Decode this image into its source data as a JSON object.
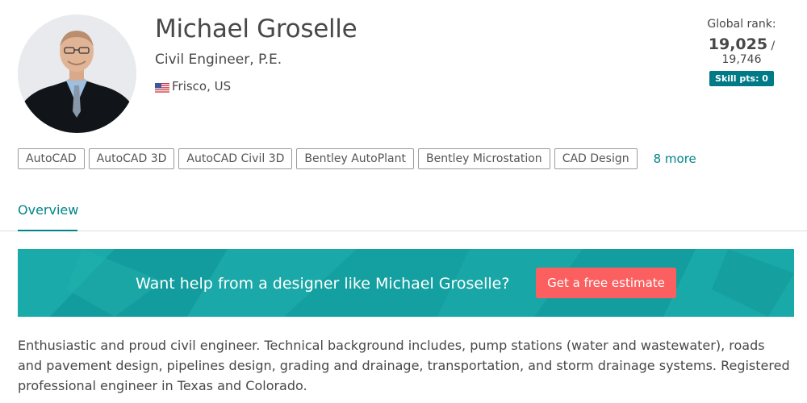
{
  "profile": {
    "name": "Michael Groselle",
    "title": "Civil Engineer, P.E.",
    "location": "Frisco, US",
    "flag": "us-flag-icon",
    "avatar": "profile-photo"
  },
  "rank": {
    "label": "Global rank:",
    "current": "19,025",
    "separator": " / ",
    "total": "19,746",
    "skill_points": "Skill pts: 0"
  },
  "skills": {
    "tags": [
      "AutoCAD",
      "AutoCAD 3D",
      "AutoCAD Civil 3D",
      "Bentley AutoPlant",
      "Bentley Microstation",
      "CAD Design"
    ],
    "more_label": "8 more"
  },
  "tabs": {
    "overview": "Overview"
  },
  "cta": {
    "text": "Want help from a designer like Michael Groselle?",
    "button": "Get a free estimate"
  },
  "bio": "Enthusiastic and proud civil engineer. Technical background includes, pump stations (water and wastewater), roads and pavement design, pipelines design, grading and drainage, transportation, and storm drainage systems. Registered professional engineer in Texas and Colorado.",
  "colors": {
    "accent": "#008489",
    "badge": "#007a87",
    "banner": "#17a3a3",
    "button": "#fc5f5f"
  }
}
